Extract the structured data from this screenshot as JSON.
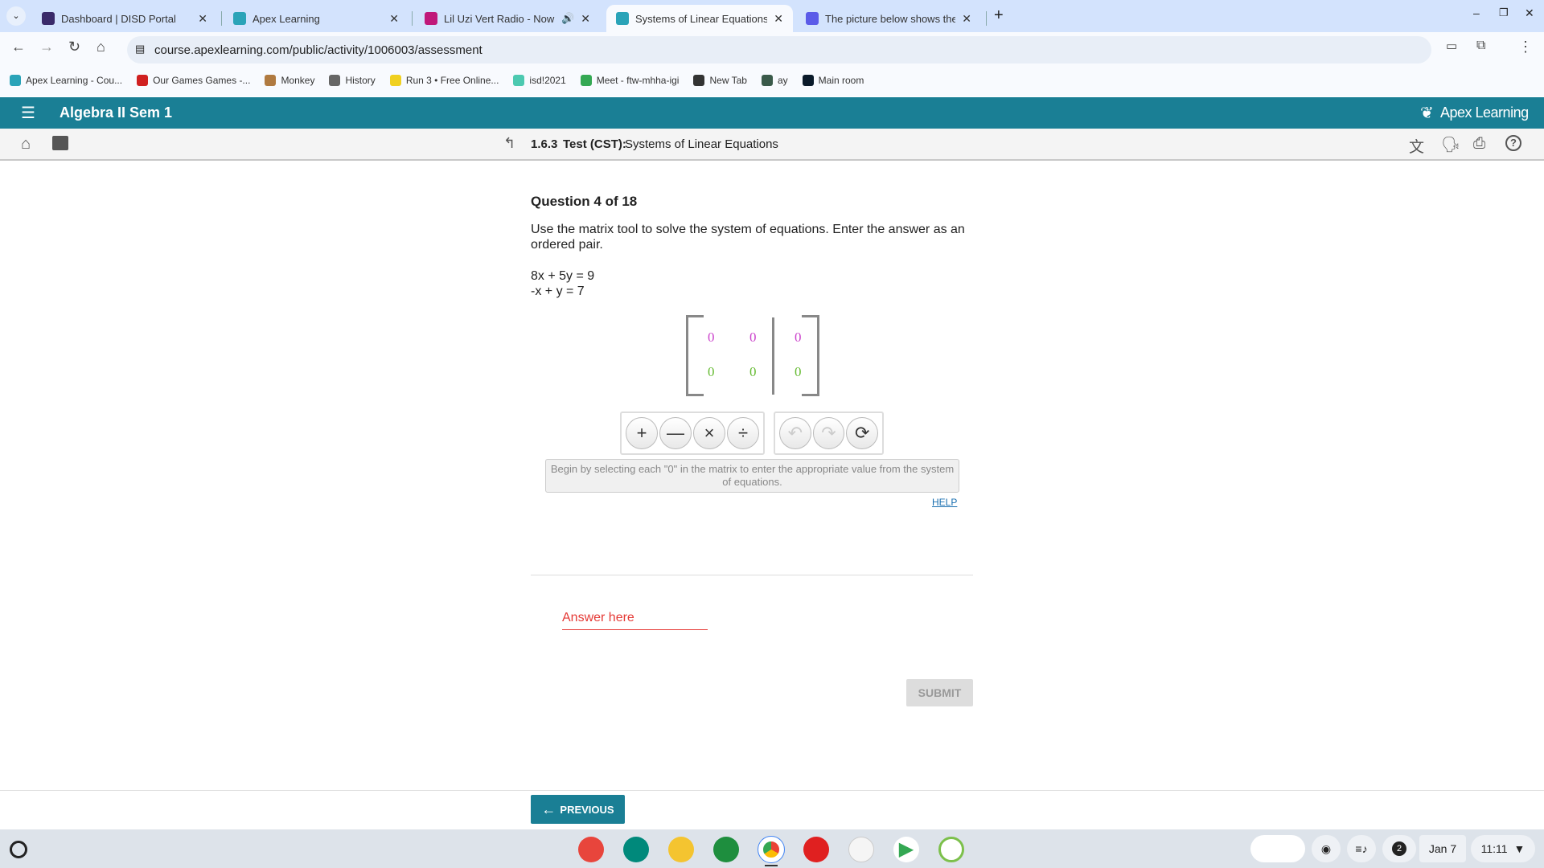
{
  "browser": {
    "tabs": [
      {
        "title": "Dashboard | DISD Portal",
        "color": "#3a2a6a"
      },
      {
        "title": "Apex Learning",
        "color": "#2aa3b8"
      },
      {
        "title": "Lil Uzi Vert Radio - Now Pla",
        "color": "#c0187a"
      },
      {
        "title": "Systems of Linear Equations - A",
        "color": "#2aa3b8",
        "active": true
      },
      {
        "title": "The picture below shows the sc",
        "color": "#5b5be8"
      }
    ],
    "url": "course.apexlearning.com/public/activity/1006003/assessment",
    "bookmarks": [
      {
        "label": "Apex Learning - Cou...",
        "color": "#2aa3b8"
      },
      {
        "label": "Our Games Games -...",
        "color": "#d02020"
      },
      {
        "label": "Monkey",
        "color": "#b07a40"
      },
      {
        "label": "History",
        "color": "#666"
      },
      {
        "label": "Run 3 • Free Online...",
        "color": "#f0d020"
      },
      {
        "label": "isd!2021",
        "color": "#4cc9b0"
      },
      {
        "label": "Meet - ftw-mhha-igi",
        "color": "#34a853"
      },
      {
        "label": "New Tab",
        "color": "#333"
      },
      {
        "label": "ay",
        "color": "#3a5a4a"
      },
      {
        "label": "Main room",
        "color": "#0a1a2a"
      }
    ]
  },
  "app": {
    "course_title": "Algebra II Sem 1",
    "brand": "Apex Learning",
    "accent": "#1a7f95"
  },
  "activity": {
    "number": "1.6.3",
    "type": "Test (CST):",
    "title": "Systems of Linear Equations"
  },
  "question": {
    "counter": "Question 4 of 18",
    "prompt": "Use the matrix tool to solve the system of equations. Enter the answer as an ordered pair.",
    "eq1": "8x + 5y = 9",
    "eq2": "-x + y = 7"
  },
  "matrix": {
    "row1": [
      "0",
      "0",
      "0"
    ],
    "row2": [
      "0",
      "0",
      "0"
    ],
    "row1_color": "#cc44cc",
    "row2_color": "#66bb33"
  },
  "tools": {
    "ops": [
      "+",
      "—",
      "×",
      "÷"
    ],
    "undo": "↶",
    "redo": "↷",
    "reset": "⟳"
  },
  "hint": "Begin by selecting each \"0\" in the matrix to enter the appropriate value from the system of equations.",
  "help": "HELP",
  "answer_placeholder": "Answer here",
  "submit": "SUBMIT",
  "previous": "PREVIOUS",
  "taskbar": {
    "date": "Jan 7",
    "time": "11:11",
    "notifications": "2"
  }
}
